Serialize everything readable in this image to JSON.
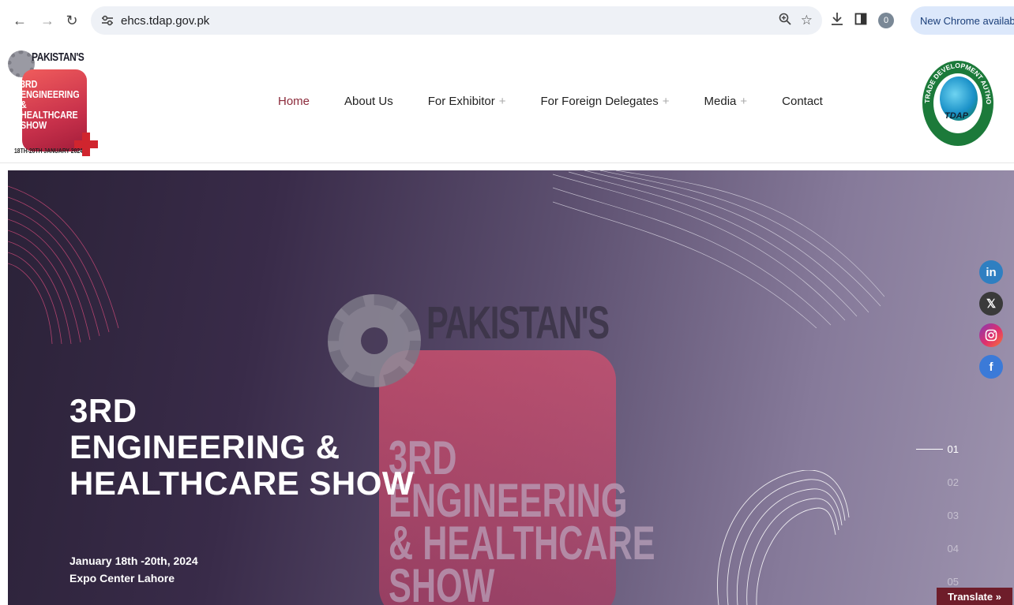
{
  "browser": {
    "url": "ehcs.tdap.gov.pk",
    "profile_count": "0",
    "update_label": "New Chrome available"
  },
  "logo": {
    "brand": "PAKISTAN'S",
    "sub_lines": [
      "3RD",
      "ENGINEERING",
      "& HEALTHCARE",
      "SHOW"
    ],
    "date": "18TH-20TH JANUARY 2024"
  },
  "nav": {
    "items": [
      {
        "label": "Home",
        "has_submenu": false
      },
      {
        "label": "About Us",
        "has_submenu": false
      },
      {
        "label": "For Exhibitor",
        "has_submenu": true
      },
      {
        "label": "For Foreign Delegates",
        "has_submenu": true
      },
      {
        "label": "Media",
        "has_submenu": true
      },
      {
        "label": "Contact",
        "has_submenu": false
      }
    ],
    "plus": "+"
  },
  "seal": {
    "text": "TRADE DEVELOPMENT AUTHORITY OF PAKISTAN",
    "abbr": "TDAP"
  },
  "hero": {
    "headline": [
      "3RD",
      "ENGINEERING &",
      "HEALTHCARE SHOW"
    ],
    "date": "January 18th -20th, 2024",
    "venue": "Expo Center Lahore",
    "ghost_brand": "PAKISTAN'S",
    "ghost_sub": [
      "3RD",
      "ENGINEERING",
      "& HEALTHCARE",
      "SHOW"
    ]
  },
  "social": [
    "linkedin-icon",
    "x-icon",
    "instagram-icon",
    "facebook-icon"
  ],
  "slides": [
    "01",
    "02",
    "03",
    "04",
    "05"
  ],
  "translate_label": "Translate »",
  "colors": {
    "accent": "#8b2a3a",
    "hero_dark": "#2b2238",
    "hero_light": "#9d93ae",
    "translate_bg": "#6e1d2a"
  }
}
